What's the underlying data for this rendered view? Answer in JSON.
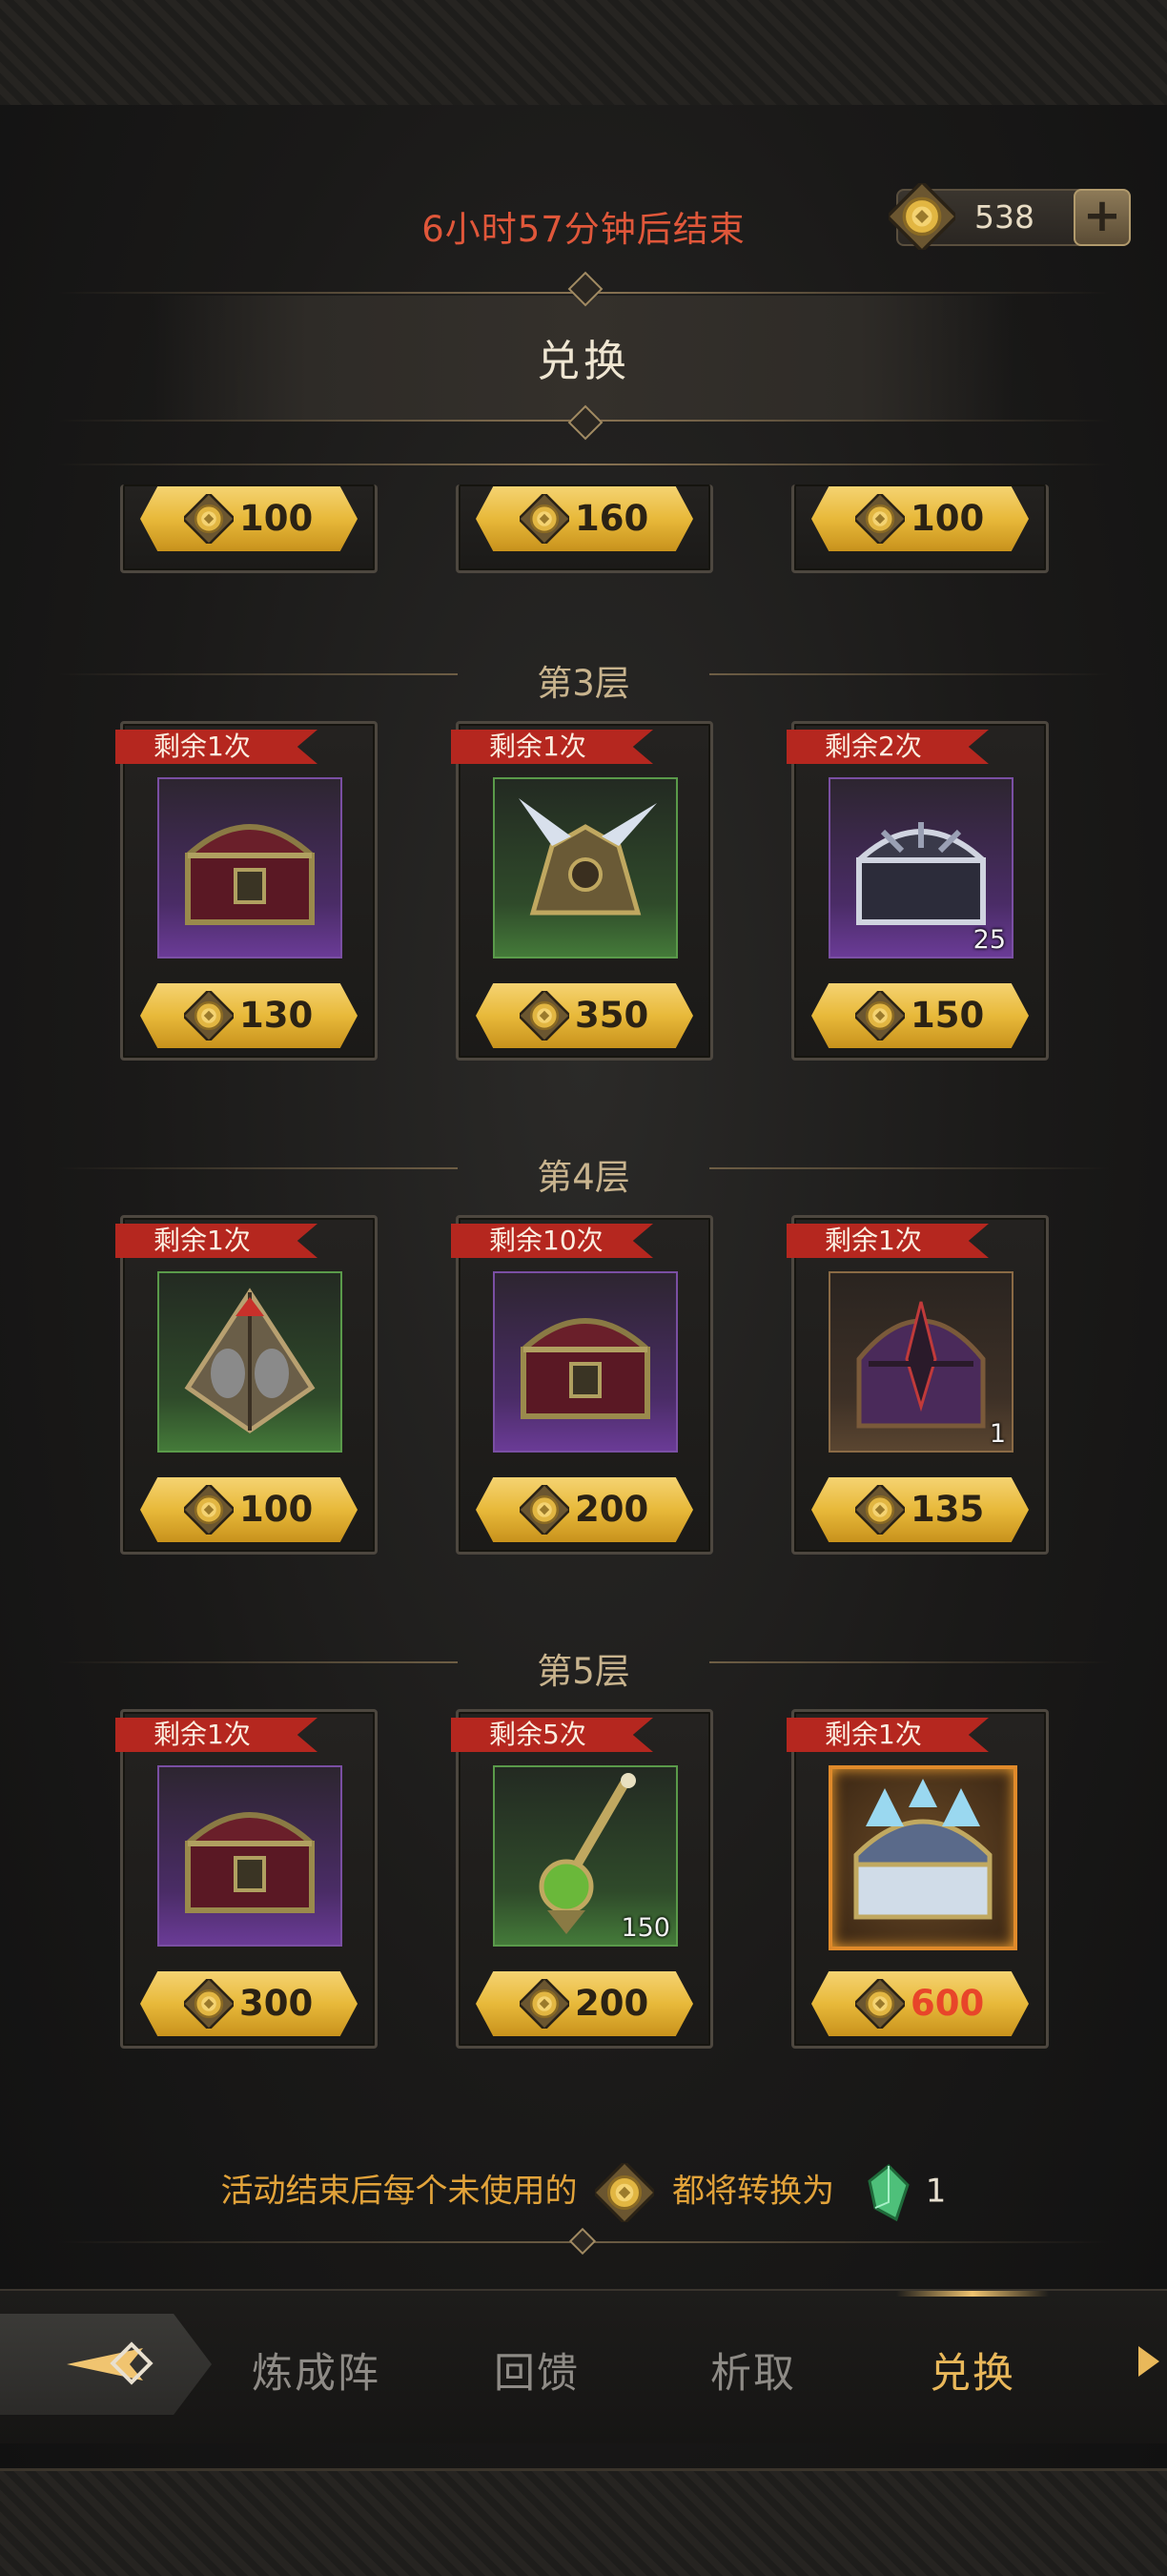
{
  "header": {
    "timer_text": "6小时57分钟后结束",
    "currency_amount": "538",
    "plus_icon": "plus-icon",
    "title": "兑换"
  },
  "partial_row": {
    "prices": [
      "100",
      "160",
      "100"
    ]
  },
  "tiers": [
    {
      "label": "第3层",
      "items": [
        {
          "remaining": "剩余1次",
          "icon": "treasure-chest-icon",
          "rarity": "purple",
          "count": "",
          "price": "130"
        },
        {
          "remaining": "剩余1次",
          "icon": "spiked-armor-icon",
          "rarity": "green",
          "count": "",
          "price": "350"
        },
        {
          "remaining": "剩余2次",
          "icon": "silver-chest-icon",
          "rarity": "purple",
          "count": "25",
          "price": "150"
        }
      ]
    },
    {
      "label": "第4层",
      "items": [
        {
          "remaining": "剩余1次",
          "icon": "pyramid-relic-icon",
          "rarity": "green",
          "count": "",
          "price": "100"
        },
        {
          "remaining": "剩余10次",
          "icon": "treasure-chest-icon",
          "rarity": "purple",
          "count": "",
          "price": "200"
        },
        {
          "remaining": "剩余1次",
          "icon": "dark-helm-chest-icon",
          "rarity": "brown",
          "count": "1",
          "price": "135"
        }
      ]
    },
    {
      "label": "第5层",
      "items": [
        {
          "remaining": "剩余1次",
          "icon": "treasure-chest-icon",
          "rarity": "purple",
          "count": "",
          "price": "300"
        },
        {
          "remaining": "剩余5次",
          "icon": "scepter-icon",
          "rarity": "green",
          "count": "150",
          "price": "200"
        },
        {
          "remaining": "剩余1次",
          "icon": "crystal-chest-icon",
          "rarity": "orange",
          "count": "",
          "price": "600",
          "price_insufficient": true
        }
      ]
    }
  ],
  "footer": {
    "text_before": "活动结束后每个未使用的",
    "text_middle": "都将转换为",
    "gem_amount": "1"
  },
  "nav": {
    "back_icon": "diamond-arrow-back-icon",
    "items": [
      "炼成阵",
      "回馈",
      "析取",
      "兑换"
    ],
    "active": "兑换",
    "more_icon": "chevron-right-icon"
  },
  "colors": {
    "timer": "#e0573a",
    "ribbon": "#b5271f",
    "price_button": "#e8b93a",
    "price_insufficient": "#e8452a",
    "nav_active": "#e9b85a",
    "footer_text": "#e2a33a"
  }
}
